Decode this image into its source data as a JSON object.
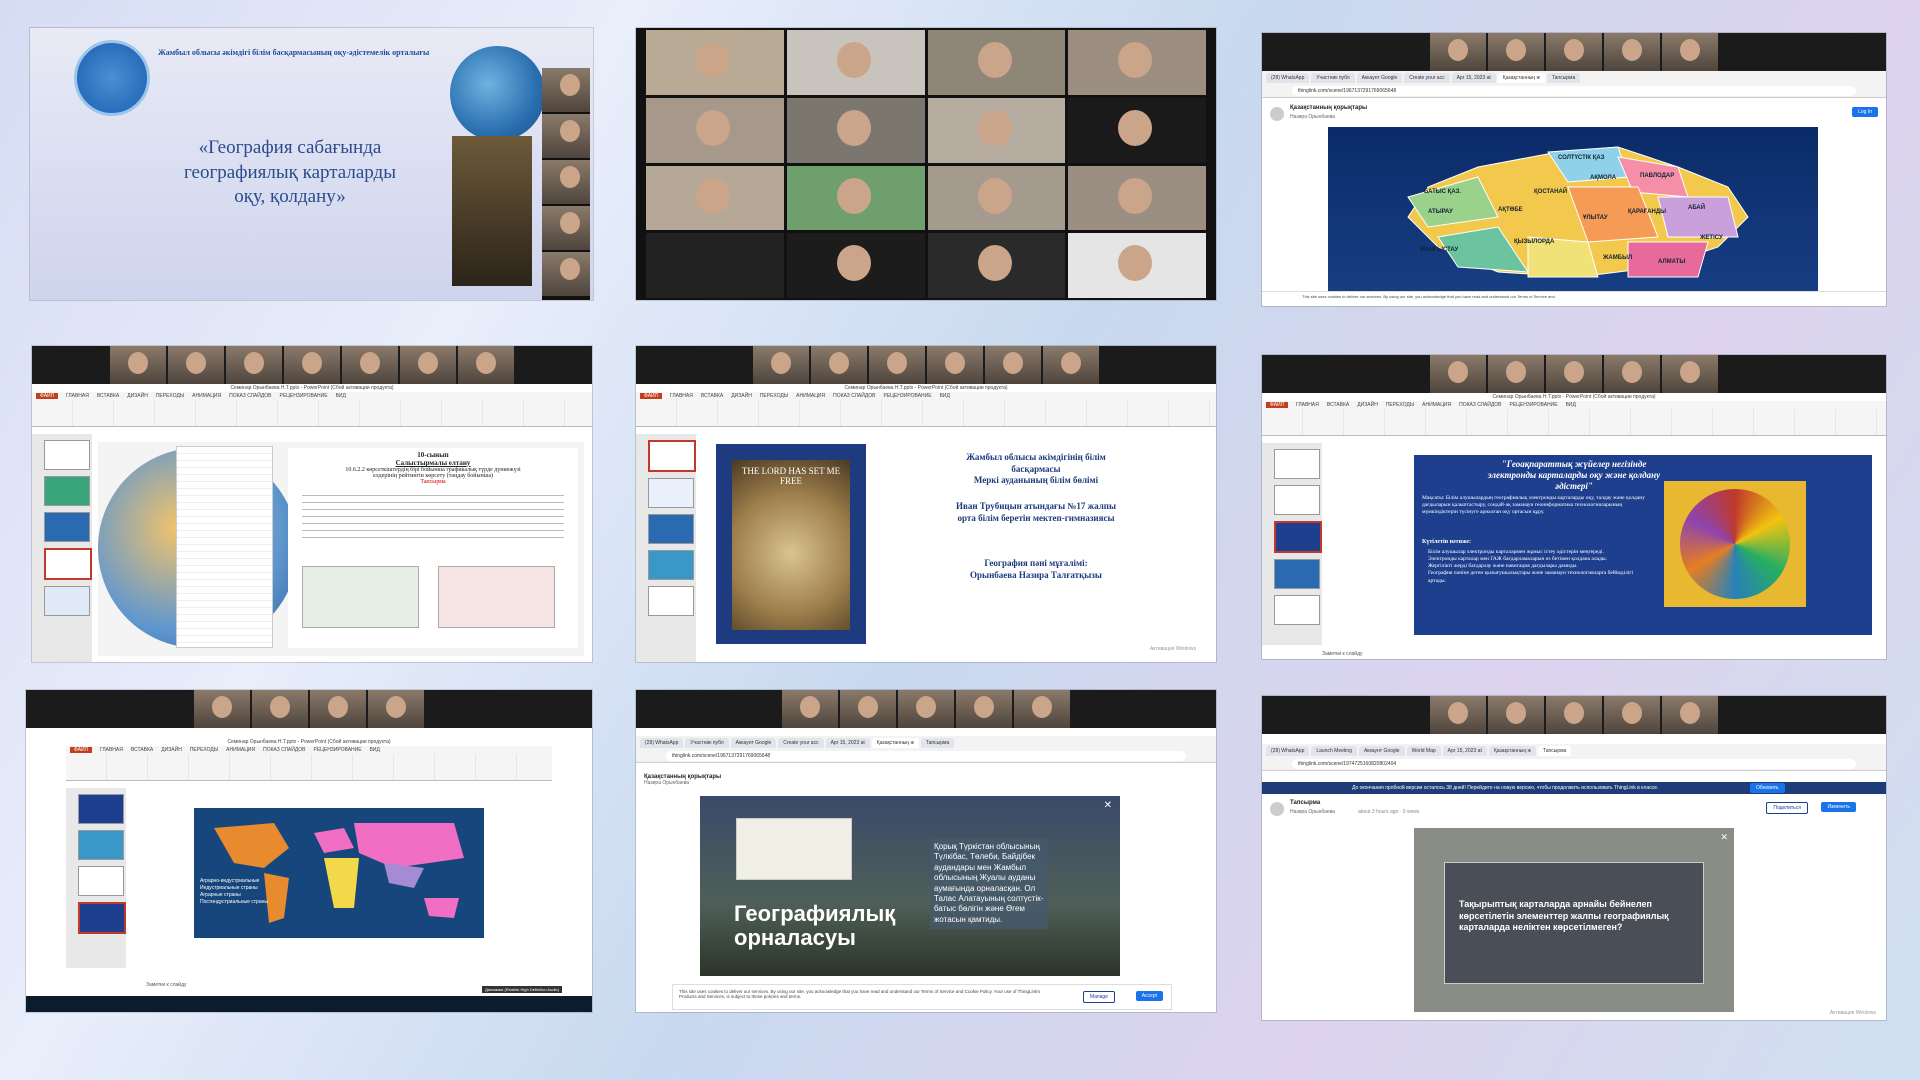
{
  "p1": {
    "org": "Жамбыл облысы әкімдігі білім басқармасының оқу-әдістемелік орталығы",
    "title_l1": "«География сабағында",
    "title_l2": "географиялық карталарды",
    "title_l3": "оқу, қолдану»"
  },
  "p3": {
    "tabs": [
      "(28) WhatsApp",
      "Участник публ",
      "Аккаунт Google",
      "Create your acc",
      "Apr 15, 2023 at",
      "Қазақстанның ж",
      "Тапсырма"
    ],
    "url": "thinglink.com/scene/1967137291769065648",
    "channel": "Қазақстанның қорықтары",
    "author": "Назира Орынбаева",
    "login": "Log In",
    "regions": [
      "СОЛТҮСТІК ҚАЗ",
      "АҚМОЛА",
      "ПАВЛОДАР",
      "БАТЫС ҚАЗ.",
      "ҚОСТАНАЙ",
      "АТЫРАУ",
      "АҚТӨБЕ",
      "ҰЛЫТАУ",
      "ҚАРАҒАНДЫ",
      "АБАЙ",
      "МАҢҒЫСТАУ",
      "ҚЫЗЫЛОРДА",
      "ЖАМБЫЛ",
      "АЛМАТЫ",
      "ЖЕТІСУ"
    ],
    "cookie": "This site uses cookies to deliver our services. By using our site, you acknowledge that you have read and understand our Terms of Service and"
  },
  "p4": {
    "ppt_title": "Семинар Орынбаева Н.Т.pptx - PowerPoint (Сбой активации продукта)",
    "menu": [
      "ФАЙЛ",
      "ГЛАВНАЯ",
      "ВСТАВКА",
      "ДИЗАЙН",
      "ПЕРЕХОДЫ",
      "АНИМАЦИЯ",
      "ПОКАЗ СЛАЙДОВ",
      "РЕЦЕНЗИРОВАНИЕ",
      "ВИД"
    ],
    "doc_class": "10-сынып",
    "doc_heading": "Салыстырмалы елтану",
    "doc_line1": "10.6.2.2 көрсеткіштердің бірі бойынша графикалық түрде дүниежүзі",
    "doc_line2": "елдерінің рейтингін көрсету (таңдау бойынша)",
    "doc_task": "Тапсырма"
  },
  "p5": {
    "book": "THE LORD HAS SET ME FREE",
    "l1": "Жамбыл облысы әкімдігінің білім",
    "l2": "басқармасы",
    "l3": "Меркі ауданының білім бөлімі",
    "l4": "Иван Трубицын атындағы №17 жалпы",
    "l5": "орта білім беретін мектеп-гимназиясы",
    "l6": "География пәні мұғалімі:",
    "l7": "Орынбаева Назира Талғатқызы",
    "activation": "Активация Windows"
  },
  "p6": {
    "title_l1": "\"Геоақпараттық жүйелер негізінде",
    "title_l2": "электронды карталарды оқу және қолдану",
    "title_l3": "әдістері\"",
    "goal": "Мақсаты: Білім алушылардың географиялық электронды карталарды оқу, талдау және қолдану дағдыларын қалыптастыру, сондай-ақ заманауи геоинформатика технологияларының мүмкіндіктерін түсінуге арналған оқу ортасын құру.",
    "result": "Күтілетін нәтиже:",
    "bullets": [
      "Білім алушылар электронды карталармен жұмыс істеу әдістерін меңгереді.",
      "Электронды карталар мен ГАЖ бағдарламаларын өз бетімен қолдана алады.",
      "Жергілікті жерді бағдарлау және навигация дағдылары дамиды.",
      "География пәніне деген қызығушылықтары және заманауи технологияларға бейімділігі артады."
    ],
    "notes": "Заметки к слайду"
  },
  "p7": {
    "legend": [
      "Аграрно-индустриальные",
      "Индустриальные страны",
      "Аграрные страны",
      "Постиндустриальные страны"
    ],
    "notes": "Заметки к слайду",
    "device": "Динамики (Realtek High Definition Audio)",
    "volume": "51"
  },
  "p8": {
    "tabs": [
      "(28) WhatsApp",
      "Участник публ",
      "Аккаунт Google",
      "Create your acc",
      "Apr 15, 2023 at",
      "Қазақстанның ж",
      "Тапсырма"
    ],
    "url": "thinglink.com/scene/1967137291769065648",
    "channel": "Қазақстанның қорықтары",
    "author": "Назира Орынбаева",
    "big1": "Географиялық",
    "big2": "орналасуы",
    "info": "Қорық Түркістан облысының Түлкібас, Төлеби, Байдібек аудандары мен Жамбыл облысының Жуалы ауданы аумағында орналасқан. Ол Талас Алатауының солтүстік-батыс бөлігін және Өгем жотасын қамтиды.",
    "cookie": "This site uses cookies to deliver our services. By using our site, you acknowledge that you have read and understand our Terms of Service and Cookie Policy. Your use of ThingLink's Products and Services, is subject to these policies and terms.",
    "manage": "Manage",
    "accept": "Accept"
  },
  "p9": {
    "tabs": [
      "(28) WhatsApp",
      "Launch Meeting",
      "Аккаунт Google",
      "World Map",
      "Apr 15, 2023 at",
      "Қазақстанның ж",
      "Тапсырма"
    ],
    "url": "thinglink.com/scene/1974725160820802404",
    "trial": "До окончания пробной версии осталось 38 дней! Перейдите на новую версию, чтобы продолжить использовать ThingLink в классе.",
    "update": "Обновить",
    "channel": "Тапсырма",
    "author": "Назира Орынбаева",
    "meta": "about 3 hours ago · 0 views",
    "share": "Поделиться",
    "edit": "Изменить",
    "question": "Тақырыптық карталарда арнайы бейнелеп көрсетілетін элементтер жалпы географиялық карталарда неліктен көрсетілмеген?",
    "activation": "Активация Windows"
  }
}
